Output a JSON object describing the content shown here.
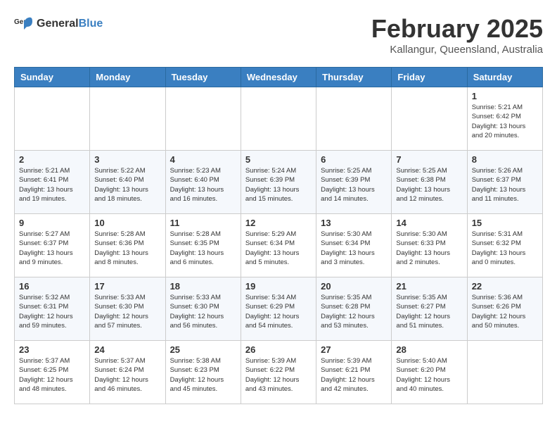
{
  "logo": {
    "general": "General",
    "blue": "Blue"
  },
  "header": {
    "title": "February 2025",
    "subtitle": "Kallangur, Queensland, Australia"
  },
  "weekdays": [
    "Sunday",
    "Monday",
    "Tuesday",
    "Wednesday",
    "Thursday",
    "Friday",
    "Saturday"
  ],
  "weeks": [
    [
      {
        "day": "",
        "info": ""
      },
      {
        "day": "",
        "info": ""
      },
      {
        "day": "",
        "info": ""
      },
      {
        "day": "",
        "info": ""
      },
      {
        "day": "",
        "info": ""
      },
      {
        "day": "",
        "info": ""
      },
      {
        "day": "1",
        "info": "Sunrise: 5:21 AM\nSunset: 6:42 PM\nDaylight: 13 hours\nand 20 minutes."
      }
    ],
    [
      {
        "day": "2",
        "info": "Sunrise: 5:21 AM\nSunset: 6:41 PM\nDaylight: 13 hours\nand 19 minutes."
      },
      {
        "day": "3",
        "info": "Sunrise: 5:22 AM\nSunset: 6:40 PM\nDaylight: 13 hours\nand 18 minutes."
      },
      {
        "day": "4",
        "info": "Sunrise: 5:23 AM\nSunset: 6:40 PM\nDaylight: 13 hours\nand 16 minutes."
      },
      {
        "day": "5",
        "info": "Sunrise: 5:24 AM\nSunset: 6:39 PM\nDaylight: 13 hours\nand 15 minutes."
      },
      {
        "day": "6",
        "info": "Sunrise: 5:25 AM\nSunset: 6:39 PM\nDaylight: 13 hours\nand 14 minutes."
      },
      {
        "day": "7",
        "info": "Sunrise: 5:25 AM\nSunset: 6:38 PM\nDaylight: 13 hours\nand 12 minutes."
      },
      {
        "day": "8",
        "info": "Sunrise: 5:26 AM\nSunset: 6:37 PM\nDaylight: 13 hours\nand 11 minutes."
      }
    ],
    [
      {
        "day": "9",
        "info": "Sunrise: 5:27 AM\nSunset: 6:37 PM\nDaylight: 13 hours\nand 9 minutes."
      },
      {
        "day": "10",
        "info": "Sunrise: 5:28 AM\nSunset: 6:36 PM\nDaylight: 13 hours\nand 8 minutes."
      },
      {
        "day": "11",
        "info": "Sunrise: 5:28 AM\nSunset: 6:35 PM\nDaylight: 13 hours\nand 6 minutes."
      },
      {
        "day": "12",
        "info": "Sunrise: 5:29 AM\nSunset: 6:34 PM\nDaylight: 13 hours\nand 5 minutes."
      },
      {
        "day": "13",
        "info": "Sunrise: 5:30 AM\nSunset: 6:34 PM\nDaylight: 13 hours\nand 3 minutes."
      },
      {
        "day": "14",
        "info": "Sunrise: 5:30 AM\nSunset: 6:33 PM\nDaylight: 13 hours\nand 2 minutes."
      },
      {
        "day": "15",
        "info": "Sunrise: 5:31 AM\nSunset: 6:32 PM\nDaylight: 13 hours\nand 0 minutes."
      }
    ],
    [
      {
        "day": "16",
        "info": "Sunrise: 5:32 AM\nSunset: 6:31 PM\nDaylight: 12 hours\nand 59 minutes."
      },
      {
        "day": "17",
        "info": "Sunrise: 5:33 AM\nSunset: 6:30 PM\nDaylight: 12 hours\nand 57 minutes."
      },
      {
        "day": "18",
        "info": "Sunrise: 5:33 AM\nSunset: 6:30 PM\nDaylight: 12 hours\nand 56 minutes."
      },
      {
        "day": "19",
        "info": "Sunrise: 5:34 AM\nSunset: 6:29 PM\nDaylight: 12 hours\nand 54 minutes."
      },
      {
        "day": "20",
        "info": "Sunrise: 5:35 AM\nSunset: 6:28 PM\nDaylight: 12 hours\nand 53 minutes."
      },
      {
        "day": "21",
        "info": "Sunrise: 5:35 AM\nSunset: 6:27 PM\nDaylight: 12 hours\nand 51 minutes."
      },
      {
        "day": "22",
        "info": "Sunrise: 5:36 AM\nSunset: 6:26 PM\nDaylight: 12 hours\nand 50 minutes."
      }
    ],
    [
      {
        "day": "23",
        "info": "Sunrise: 5:37 AM\nSunset: 6:25 PM\nDaylight: 12 hours\nand 48 minutes."
      },
      {
        "day": "24",
        "info": "Sunrise: 5:37 AM\nSunset: 6:24 PM\nDaylight: 12 hours\nand 46 minutes."
      },
      {
        "day": "25",
        "info": "Sunrise: 5:38 AM\nSunset: 6:23 PM\nDaylight: 12 hours\nand 45 minutes."
      },
      {
        "day": "26",
        "info": "Sunrise: 5:39 AM\nSunset: 6:22 PM\nDaylight: 12 hours\nand 43 minutes."
      },
      {
        "day": "27",
        "info": "Sunrise: 5:39 AM\nSunset: 6:21 PM\nDaylight: 12 hours\nand 42 minutes."
      },
      {
        "day": "28",
        "info": "Sunrise: 5:40 AM\nSunset: 6:20 PM\nDaylight: 12 hours\nand 40 minutes."
      },
      {
        "day": "",
        "info": ""
      }
    ]
  ]
}
